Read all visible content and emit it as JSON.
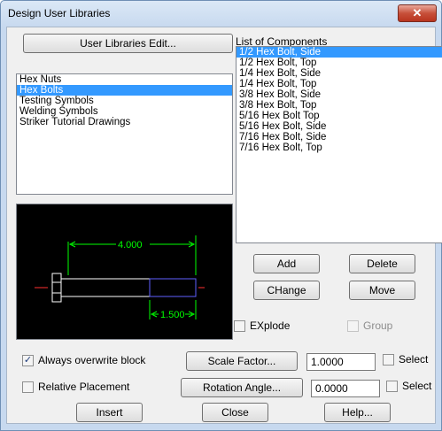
{
  "window": {
    "title": "Design User Libraries",
    "close_glyph": "✕"
  },
  "buttons": {
    "user_libraries_edit": "User Libraries Edit...",
    "add": "Add",
    "delete": "Delete",
    "change": "CHange",
    "move": "Move",
    "scale_factor": "Scale Factor...",
    "rotation_angle": "Rotation Angle...",
    "insert": "Insert",
    "close": "Close",
    "help": "Help..."
  },
  "components_label": "List of Components",
  "libraries": [
    {
      "label": "Hex Nuts",
      "selected": false
    },
    {
      "label": "Hex Bolts",
      "selected": true
    },
    {
      "label": "Testing Symbols",
      "selected": false
    },
    {
      "label": "Welding Symbols",
      "selected": false
    },
    {
      "label": "Striker Tutorial Drawings",
      "selected": false
    }
  ],
  "components": [
    {
      "label": "1/2 Hex Bolt, Side",
      "selected": true
    },
    {
      "label": "1/2 Hex Bolt, Top",
      "selected": false
    },
    {
      "label": "1/4 Hex Bolt, Side",
      "selected": false
    },
    {
      "label": "1/4 Hex Bolt, Top",
      "selected": false
    },
    {
      "label": "3/8 Hex Bolt, Side",
      "selected": false
    },
    {
      "label": "3/8 Hex Bolt, Top",
      "selected": false
    },
    {
      "label": "5/16 Hex Bolt Top",
      "selected": false
    },
    {
      "label": "5/16 Hex Bolt, Side",
      "selected": false
    },
    {
      "label": "7/16 Hex Bolt, Side",
      "selected": false
    },
    {
      "label": "7/16 Hex Bolt, Top",
      "selected": false
    }
  ],
  "preview": {
    "dim_length": "4.000",
    "dim_thread": "1.500"
  },
  "options": {
    "explode": {
      "label": "EXplode",
      "checked": false
    },
    "group": {
      "label": "Group",
      "checked": false,
      "enabled": false
    },
    "always_overwrite": {
      "label": "Always overwrite block",
      "checked": true
    },
    "relative_placement": {
      "label": "Relative Placement",
      "checked": false
    },
    "scale_select": {
      "label": "Select",
      "checked": false
    },
    "rotation_select": {
      "label": "Select",
      "checked": false
    }
  },
  "fields": {
    "scale_factor": "1.0000",
    "rotation_angle": "0.0000"
  },
  "check_glyph": "✓"
}
